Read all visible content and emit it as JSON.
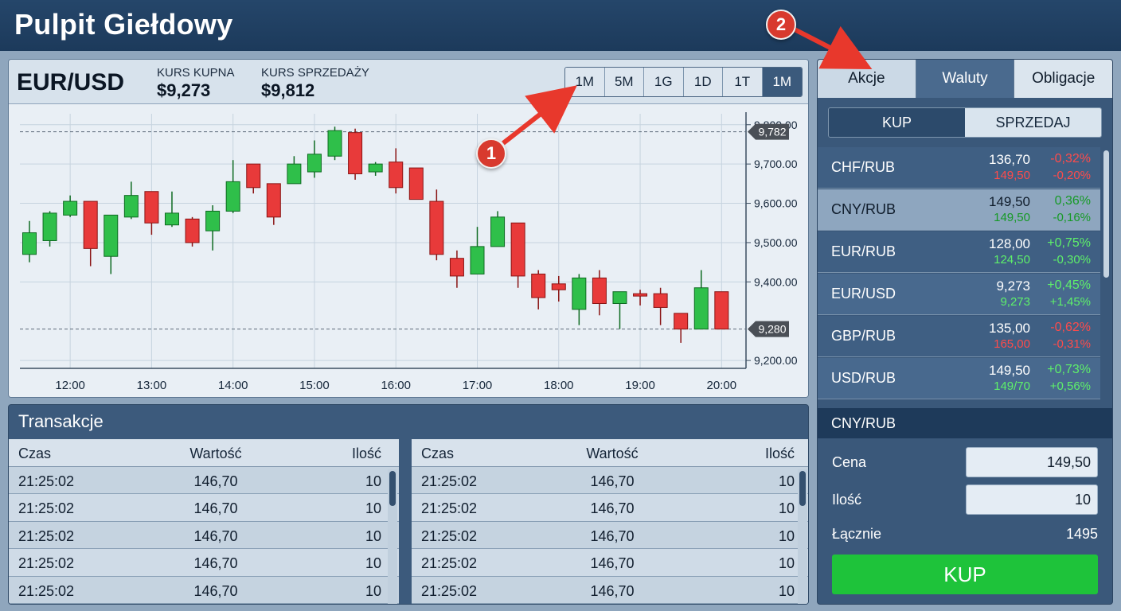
{
  "app": {
    "title": "Pulpit Giełdowy"
  },
  "chart_header": {
    "pair": "EUR/USD",
    "buy_label": "KURS KUPNA",
    "buy_value": "$9,273",
    "sell_label": "KURS SPRZEDAŻY",
    "sell_value": "$9,812",
    "timeframes": [
      "1M",
      "5M",
      "1G",
      "1D",
      "1T",
      "1M"
    ],
    "active_timeframe_index": 5
  },
  "chart_data": {
    "type": "candlestick",
    "x_ticks": [
      "12:00",
      "13:00",
      "14:00",
      "15:00",
      "16:00",
      "17:00",
      "18:00",
      "19:00",
      "20:00"
    ],
    "y_ticks": [
      "9,800.00",
      "9,700.00",
      "9,600.00",
      "9,500.00",
      "9,400.00",
      "9,200.00"
    ],
    "y_tick_values": [
      9800,
      9700,
      9600,
      9500,
      9400,
      9200
    ],
    "ylim": [
      9180,
      9840
    ],
    "x_range": [
      11.5,
      20.3
    ],
    "grid": true,
    "price_lines": [
      {
        "label": "9,782",
        "value": 9782
      },
      {
        "label": "9,280",
        "value": 9280
      }
    ],
    "candles": [
      {
        "t": 11.5,
        "o": 9470,
        "h": 9555,
        "l": 9450,
        "c": 9525
      },
      {
        "t": 11.75,
        "o": 9505,
        "h": 9580,
        "l": 9490,
        "c": 9575
      },
      {
        "t": 12.0,
        "o": 9570,
        "h": 9620,
        "l": 9565,
        "c": 9605
      },
      {
        "t": 12.25,
        "o": 9605,
        "h": 9605,
        "l": 9440,
        "c": 9485
      },
      {
        "t": 12.5,
        "o": 9465,
        "h": 9570,
        "l": 9420,
        "c": 9570
      },
      {
        "t": 12.75,
        "o": 9565,
        "h": 9655,
        "l": 9560,
        "c": 9620
      },
      {
        "t": 13.0,
        "o": 9630,
        "h": 9630,
        "l": 9520,
        "c": 9550
      },
      {
        "t": 13.25,
        "o": 9545,
        "h": 9630,
        "l": 9540,
        "c": 9575
      },
      {
        "t": 13.5,
        "o": 9560,
        "h": 9565,
        "l": 9490,
        "c": 9500
      },
      {
        "t": 13.75,
        "o": 9530,
        "h": 9595,
        "l": 9480,
        "c": 9580
      },
      {
        "t": 14.0,
        "o": 9580,
        "h": 9710,
        "l": 9575,
        "c": 9655
      },
      {
        "t": 14.25,
        "o": 9700,
        "h": 9700,
        "l": 9625,
        "c": 9640
      },
      {
        "t": 14.5,
        "o": 9650,
        "h": 9650,
        "l": 9545,
        "c": 9565
      },
      {
        "t": 14.75,
        "o": 9650,
        "h": 9720,
        "l": 9650,
        "c": 9700
      },
      {
        "t": 15.0,
        "o": 9680,
        "h": 9760,
        "l": 9665,
        "c": 9725
      },
      {
        "t": 15.25,
        "o": 9720,
        "h": 9795,
        "l": 9710,
        "c": 9785
      },
      {
        "t": 15.5,
        "o": 9780,
        "h": 9790,
        "l": 9660,
        "c": 9675
      },
      {
        "t": 15.75,
        "o": 9680,
        "h": 9705,
        "l": 9670,
        "c": 9700
      },
      {
        "t": 16.0,
        "o": 9705,
        "h": 9740,
        "l": 9625,
        "c": 9640
      },
      {
        "t": 16.25,
        "o": 9690,
        "h": 9690,
        "l": 9610,
        "c": 9610
      },
      {
        "t": 16.5,
        "o": 9605,
        "h": 9635,
        "l": 9455,
        "c": 9470
      },
      {
        "t": 16.75,
        "o": 9460,
        "h": 9480,
        "l": 9385,
        "c": 9415
      },
      {
        "t": 17.0,
        "o": 9420,
        "h": 9540,
        "l": 9420,
        "c": 9490
      },
      {
        "t": 17.25,
        "o": 9490,
        "h": 9580,
        "l": 9490,
        "c": 9565
      },
      {
        "t": 17.5,
        "o": 9550,
        "h": 9550,
        "l": 9385,
        "c": 9415
      },
      {
        "t": 17.75,
        "o": 9420,
        "h": 9430,
        "l": 9330,
        "c": 9360
      },
      {
        "t": 18.0,
        "o": 9395,
        "h": 9415,
        "l": 9350,
        "c": 9380
      },
      {
        "t": 18.25,
        "o": 9330,
        "h": 9420,
        "l": 9290,
        "c": 9410
      },
      {
        "t": 18.5,
        "o": 9410,
        "h": 9430,
        "l": 9315,
        "c": 9345
      },
      {
        "t": 18.75,
        "o": 9345,
        "h": 9375,
        "l": 9280,
        "c": 9375
      },
      {
        "t": 19.0,
        "o": 9370,
        "h": 9380,
        "l": 9340,
        "c": 9365
      },
      {
        "t": 19.25,
        "o": 9370,
        "h": 9385,
        "l": 9290,
        "c": 9335
      },
      {
        "t": 19.5,
        "o": 9320,
        "h": 9320,
        "l": 9245,
        "c": 9280
      },
      {
        "t": 19.75,
        "o": 9280,
        "h": 9430,
        "l": 9280,
        "c": 9385
      },
      {
        "t": 20.0,
        "o": 9375,
        "h": 9375,
        "l": 9280,
        "c": 9280
      }
    ]
  },
  "annotations": [
    {
      "label": "1"
    },
    {
      "label": "2"
    }
  ],
  "transactions": {
    "title": "Transakcje",
    "columns": [
      "Czas",
      "Wartość",
      "Ilość"
    ],
    "left_rows": [
      [
        "21:25:02",
        "146,70",
        "10"
      ],
      [
        "21:25:02",
        "146,70",
        "10"
      ],
      [
        "21:25:02",
        "146,70",
        "10"
      ],
      [
        "21:25:02",
        "146,70",
        "10"
      ],
      [
        "21:25:02",
        "146,70",
        "10"
      ]
    ],
    "right_rows": [
      [
        "21:25:02",
        "146,70",
        "10"
      ],
      [
        "21:25:02",
        "146,70",
        "10"
      ],
      [
        "21:25:02",
        "146,70",
        "10"
      ],
      [
        "21:25:02",
        "146,70",
        "10"
      ],
      [
        "21:25:02",
        "146,70",
        "10"
      ]
    ]
  },
  "side": {
    "tabs": [
      "Akcje",
      "Waluty",
      "Obligacje"
    ],
    "active_tab_index": 1,
    "toggle": {
      "buy": "KUP",
      "sell": "SPRZEDAJ"
    },
    "pairs": [
      {
        "name": "CHF/RUB",
        "p1": "136,70",
        "p2": "149,50",
        "p2_color": "red",
        "c1": "-0,32%",
        "c1_color": "red",
        "c2": "-0,20%",
        "c2_color": "red"
      },
      {
        "name": "CNY/RUB",
        "p1": "149,50",
        "p2": "149,50",
        "p2_color": "green",
        "c1": "0,36%",
        "c1_color": "green",
        "c2": "-0,16%",
        "c2_color": "green"
      },
      {
        "name": "EUR/RUB",
        "p1": "128,00",
        "p2": "124,50",
        "p2_color": "green",
        "c1": "+0,75%",
        "c1_color": "green",
        "c2": "-0,30%",
        "c2_color": "green"
      },
      {
        "name": "EUR/USD",
        "p1": "9,273",
        "p2": "9,273",
        "p2_color": "green",
        "c1": "+0,45%",
        "c1_color": "green",
        "c2": "+1,45%",
        "c2_color": "green"
      },
      {
        "name": "GBP/RUB",
        "p1": "135,00",
        "p2": "165,00",
        "p2_color": "red",
        "c1": "-0,62%",
        "c1_color": "red",
        "c2": "-0,31%",
        "c2_color": "red"
      },
      {
        "name": "USD/RUB",
        "p1": "149,50",
        "p2": "149/70",
        "p2_color": "green",
        "c1": "+0,73%",
        "c1_color": "green",
        "c2": "+0,56%",
        "c2_color": "green"
      }
    ],
    "order": {
      "pair": "CNY/RUB",
      "price_label": "Cena",
      "price_value": "149,50",
      "qty_label": "Ilość",
      "qty_value": "10",
      "total_label": "Łącznie",
      "total_value": "1495",
      "buy_button": "KUP"
    }
  },
  "colors": {
    "up": "#2fbf4a",
    "down": "#e83a3a",
    "header": "#1c3a5b",
    "accent_buy": "#1ec33a",
    "annotation": "#d83a2e"
  }
}
